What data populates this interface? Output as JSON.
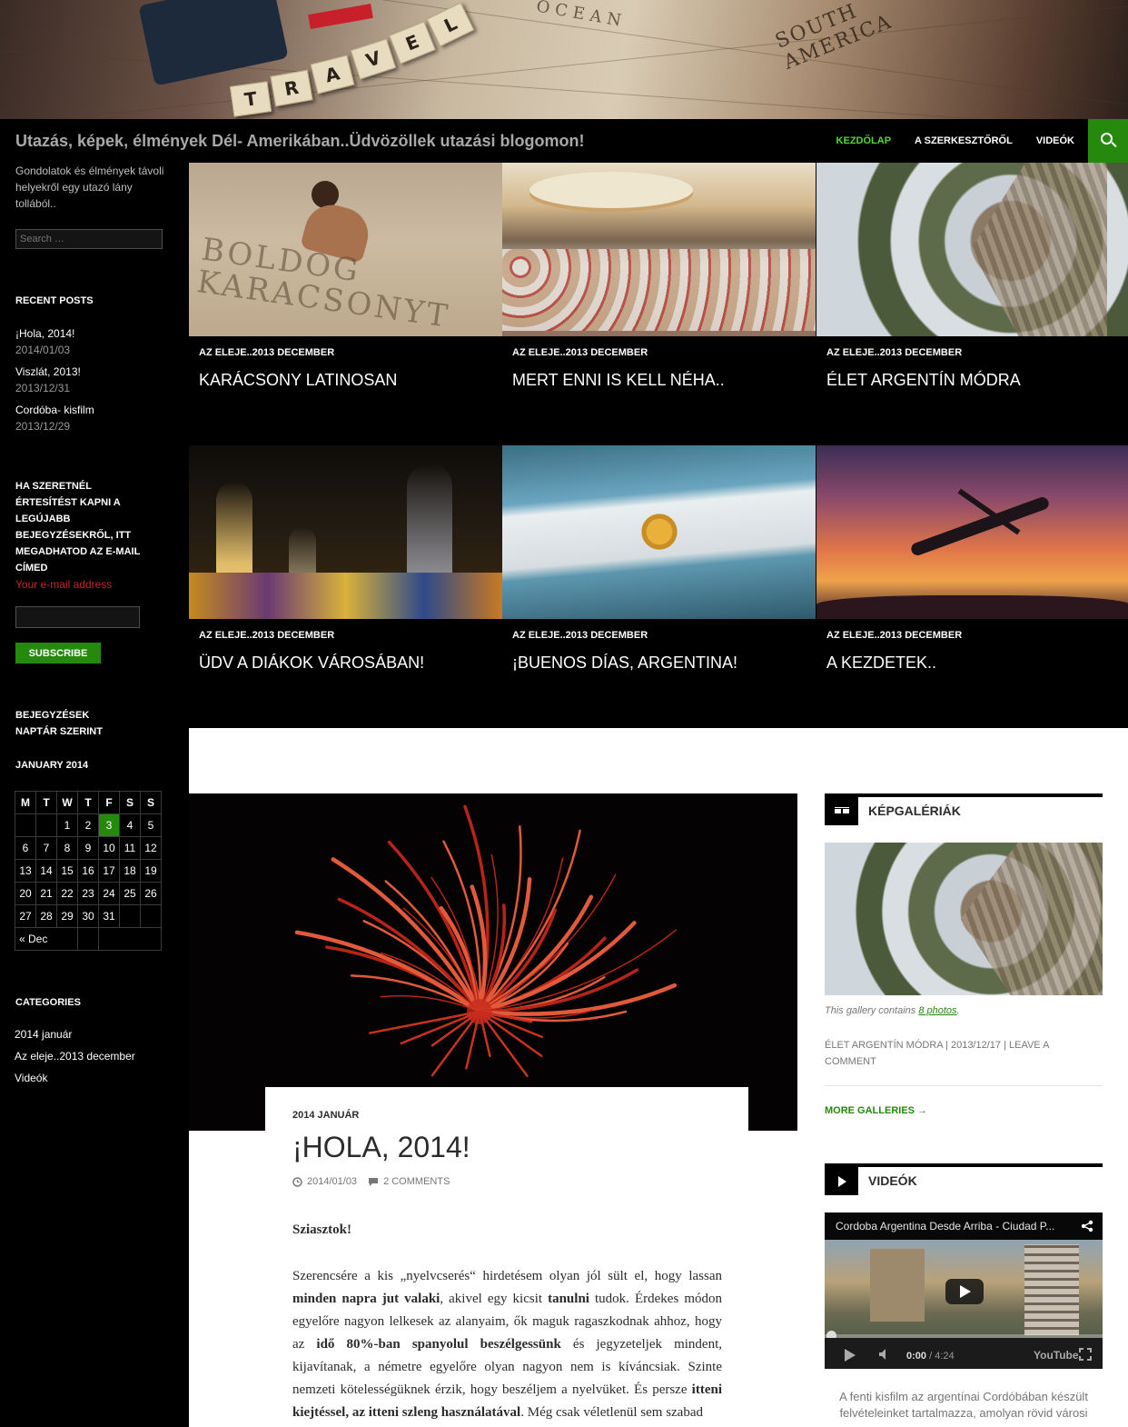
{
  "hero": {
    "tiles": [
      "T",
      "R",
      "A",
      "V",
      "E",
      "L"
    ],
    "map_text_1": "SOUTH",
    "map_text_2": "AMERICA",
    "map_text_3": "OCEAN"
  },
  "site": {
    "title": "Utazás, képek, élmények Dél- Amerikában..Üdvözöllek utazási blogomon!",
    "description": "Gondolatok és élmények távoli helyekről egy utazó lány tollából.."
  },
  "nav": {
    "items": [
      "Kezdőlap",
      "A szerkesztőről",
      "Videók"
    ],
    "search_icon": "search-icon"
  },
  "sidebar": {
    "search_placeholder": "Search …",
    "recent_posts_title": "Recent Posts",
    "recent_posts": [
      {
        "title": "¡Hola, 2014!",
        "date": "2014/01/03"
      },
      {
        "title": "Viszlát, 2013!",
        "date": "2013/12/31"
      },
      {
        "title": "Cordóba- kisfilm",
        "date": "2013/12/29"
      }
    ],
    "subscribe_title": "Ha szeretnél értesítést kapni a legújabb bejegyzésekről, itt megadhatod az e-mail címed",
    "email_label": "Your e-mail address",
    "subscribe_button": "Subscribe",
    "calendar_title": "Bejegyzések naptár szerint",
    "calendar_month": "January 2014",
    "calendar_days": [
      "M",
      "T",
      "W",
      "T",
      "F",
      "S",
      "S"
    ],
    "calendar_rows": [
      [
        "",
        "",
        "1",
        "2",
        "3",
        "4",
        "5"
      ],
      [
        "6",
        "7",
        "8",
        "9",
        "10",
        "11",
        "12"
      ],
      [
        "13",
        "14",
        "15",
        "16",
        "17",
        "18",
        "19"
      ],
      [
        "20",
        "21",
        "22",
        "23",
        "24",
        "25",
        "26"
      ],
      [
        "27",
        "28",
        "29",
        "30",
        "31",
        "",
        ""
      ]
    ],
    "calendar_today": "3",
    "calendar_prev": "« Dec",
    "categories_title": "Categories",
    "categories": [
      "2014 január",
      "Az eleje..2013 december",
      "Videók"
    ]
  },
  "featured": [
    {
      "category": "Az eleje..2013 december",
      "title": "Karácsony latinosan",
      "image": "beach-photo",
      "sand_text": "BOLDOG KARACSONYT"
    },
    {
      "category": "Az eleje..2013 december",
      "title": "Mert enni is kell néha..",
      "image": "pastry-photo"
    },
    {
      "category": "Az eleje..2013 december",
      "title": "Élet argentín módra",
      "image": "palm-photo"
    },
    {
      "category": "Az eleje..2013 december",
      "title": "Üdv a diákok városában!",
      "image": "fountain-photo"
    },
    {
      "category": "Az eleje..2013 december",
      "title": "¡Buenos días, Argentina!",
      "image": "flag-photo"
    },
    {
      "category": "Az eleje..2013 december",
      "title": "A kezdetek..",
      "image": "airplane-photo"
    }
  ],
  "post": {
    "category": "2014 január",
    "title": "¡Hola, 2014!",
    "date": "2014/01/03",
    "comments": "2 Comments",
    "greeting": "Sziasztok!",
    "body": [
      {
        "t": "Szerencsére a kis „nyelvcserés“ hirdetésem olyan jól sült el, hogy lassan ",
        "b": false
      },
      {
        "t": "minden napra jut valaki",
        "b": true
      },
      {
        "t": ", akivel egy kicsit ",
        "b": false
      },
      {
        "t": "tanulni",
        "b": true
      },
      {
        "t": " tudok. Érdekes módon egyelőre nagyon lelkesek az alanyaim, ők maguk ragaszkodnak ahhoz, hogy az ",
        "b": false
      },
      {
        "t": "idő 80%-ban spanyolul beszélgessünk",
        "b": true
      },
      {
        "t": " és jegyzeteljek mindent, kijavítanak, a németre egyelőre olyan nagyon nem is kíváncsiak. Szinte nemzeti kötelességüknek érzik, hogy beszéljem a nyelvüket. És persze ",
        "b": false
      },
      {
        "t": "itteni kiejtéssel, az itteni szleng használatával",
        "b": true
      },
      {
        "t": ". Még csak véletlenül sem szabad",
        "b": false
      }
    ]
  },
  "gallery_widget": {
    "title": "Képgalériák",
    "caption_prefix": "This gallery contains ",
    "caption_link": "8 photos",
    "caption_suffix": ".",
    "meta": "Élet argentín módra | 2013/12/17 | Leave a comment",
    "more": "More galleries →"
  },
  "video_widget": {
    "title": "Videók",
    "video_title": "Cordoba Argentina Desde Arriba - Ciudad P...",
    "time_current": "0:00",
    "time_total": "/ 4:24",
    "brand": "YouTube",
    "caption": "A fenti kisfilm az argentínai Cordóbában készült felvételeinket tartalmazza, amolyan rövid városi"
  },
  "colors": {
    "accent": "#24890d",
    "nav_active": "#55d737",
    "email_label": "#c2262b"
  }
}
